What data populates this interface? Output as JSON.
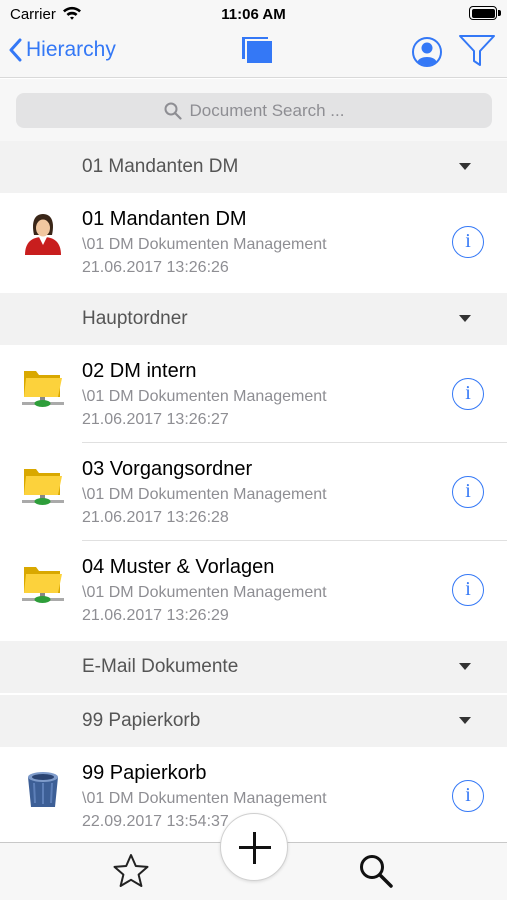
{
  "status_bar": {
    "carrier": "Carrier",
    "time": "11:06 AM"
  },
  "nav": {
    "back_label": "Hierarchy",
    "accent_color": "#3478f6",
    "center_icon": "stacked-documents-icon",
    "user_icon": "user-circle-icon",
    "filter_icon": "filter-icon"
  },
  "search": {
    "placeholder": "Document Search ..."
  },
  "sections": [
    {
      "title": "01 Mandanten DM",
      "items": [
        {
          "title": "01 Mandanten DM",
          "path": "\\01 DM Dokumenten Management",
          "date": "21.06.2017 13:26:26",
          "icon": "client-person-icon"
        }
      ]
    },
    {
      "title": "Hauptordner",
      "items": [
        {
          "title": "02 DM intern",
          "path": "\\01 DM Dokumenten Management",
          "date": "21.06.2017 13:26:27",
          "icon": "network-folder-icon"
        },
        {
          "title": "03 Vorgangsordner",
          "path": "\\01 DM Dokumenten Management",
          "date": "21.06.2017 13:26:28",
          "icon": "network-folder-icon"
        },
        {
          "title": "04 Muster & Vorlagen",
          "path": "\\01 DM Dokumenten Management",
          "date": "21.06.2017 13:26:29",
          "icon": "network-folder-icon"
        }
      ]
    },
    {
      "title": "E-Mail Dokumente",
      "items": []
    },
    {
      "title": "99 Papierkorb",
      "items": [
        {
          "title": "99 Papierkorb",
          "path": "\\01 DM Dokumenten Management",
          "date": "22.09.2017 13:54:37",
          "icon": "trash-bin-icon"
        }
      ]
    }
  ],
  "info_glyph": "i",
  "tab_bar": {
    "favorites_icon": "star-icon",
    "add_icon": "plus-icon",
    "search_icon": "magnifier-icon"
  }
}
